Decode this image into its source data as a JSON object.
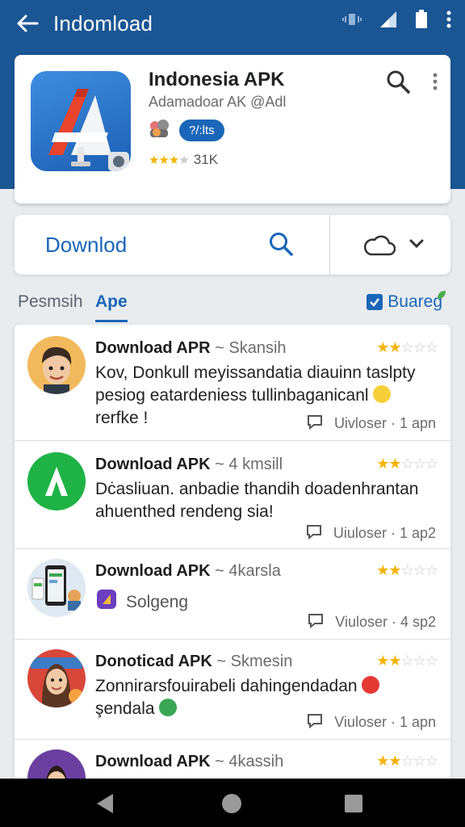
{
  "appbar": {
    "title": "Indomload"
  },
  "app": {
    "name": "Indonesia APK",
    "developer": "Adamadoar AK @Adl",
    "badge": "?/:lts",
    "rating_value": 3,
    "rating_max": 5,
    "rating_count": "31K"
  },
  "download_bar": {
    "label": "Downlod"
  },
  "tabs": {
    "tab1": "Pesmsih",
    "tab2": "Ape",
    "filter_label": "Buareg",
    "filter_checked": true
  },
  "reviews": [
    {
      "title": "Download APR",
      "meta": "~ Skansih",
      "stars": 2,
      "body": "Kov, Donkull meyissandatia diauinn taslpty pesiog eatardeniess tullinbaganicanl",
      "body_tail": "rerfke !",
      "footer": "Uivloser · 1 apn"
    },
    {
      "title": "Download APK",
      "meta": "~ 4 kmsill",
      "stars": 2,
      "body": "Dċasliuan. anbadie thandih doadenhrantan ahuenthed rendeng sia!",
      "footer": "Uiuloser · 1 ap2"
    },
    {
      "title": "Download APK",
      "meta": "~ 4karsla",
      "stars": 2,
      "sub": "Solgeng",
      "footer": "Viuloser · 4 sp2"
    },
    {
      "title": "Donoticad APK",
      "meta": "~ Skmesin",
      "stars": 2,
      "body": "Zonnirarsfouirabeli dahingendadan",
      "body_tail": "şendala",
      "footer": "Viuloser · 1 apn"
    },
    {
      "title": "Download APK",
      "meta": "~ 4kassih",
      "stars": 2
    }
  ],
  "colors": {
    "primary": "#1a5694",
    "accent": "#1a66b8",
    "star": "#f5b301"
  }
}
